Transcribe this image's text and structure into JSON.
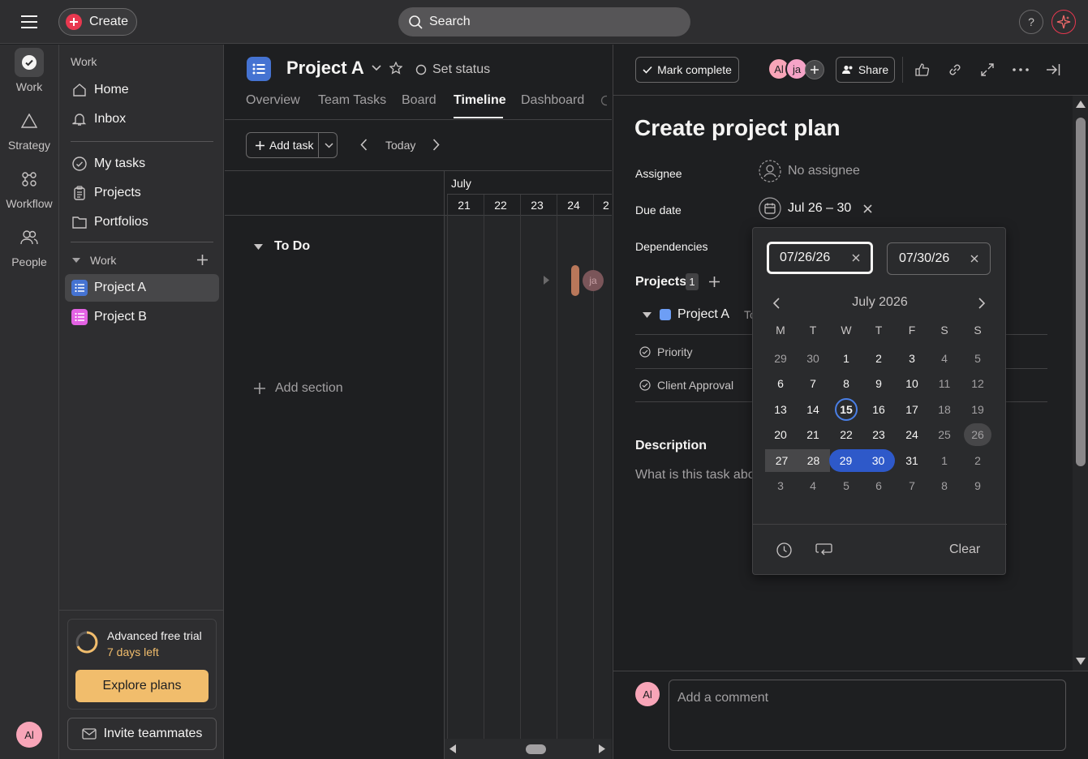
{
  "topbar": {
    "create_label": "Create",
    "search_placeholder": "Search",
    "help_label": "?"
  },
  "rail": [
    {
      "label": "Work"
    },
    {
      "label": "Strategy"
    },
    {
      "label": "Workflow"
    },
    {
      "label": "People"
    }
  ],
  "rail_avatar": "Al",
  "sidebar": {
    "section_label": "Work",
    "items": [
      {
        "label": "Home"
      },
      {
        "label": "Inbox"
      },
      {
        "label": "My tasks"
      },
      {
        "label": "Projects"
      },
      {
        "label": "Portfolios"
      }
    ],
    "work_group": "Work",
    "projects": [
      {
        "label": "Project A",
        "color": "#4573d2"
      },
      {
        "label": "Project B",
        "color": "#e362e3"
      }
    ],
    "trial_title": "Advanced free trial",
    "trial_days": "7 days left",
    "explore_label": "Explore plans",
    "invite_label": "Invite teammates"
  },
  "project": {
    "title": "Project A",
    "set_status": "Set status",
    "tabs": [
      "Overview",
      "Team Tasks",
      "Board",
      "Timeline",
      "Dashboard"
    ],
    "active_tab": "Timeline",
    "add_task": "Add task",
    "today": "Today",
    "month": "July",
    "days": [
      "21",
      "22",
      "23",
      "24",
      "2"
    ],
    "section": "To Do",
    "add_section": "Add section",
    "bar_avatar": "ja"
  },
  "detail": {
    "mark_complete": "Mark complete",
    "collab_avatars": [
      "Al",
      "ja"
    ],
    "share": "Share",
    "title": "Create project plan",
    "assignee_label": "Assignee",
    "assignee_value": "No assignee",
    "due_label": "Due date",
    "due_value": "Jul 26 – 30",
    "dependencies_label": "Dependencies",
    "projects_label": "Projects",
    "projects_count": "1",
    "project_name": "Project A",
    "project_section": "To",
    "fields": [
      "Priority",
      "Client Approval"
    ],
    "description_label": "Description",
    "description_placeholder": "What is this task abo",
    "comment_avatar": "Al",
    "comment_placeholder": "Add a comment"
  },
  "calendar": {
    "start": "07/26/26",
    "end": "07/30/26",
    "month_title": "July 2026",
    "weekdays": [
      "M",
      "T",
      "W",
      "T",
      "F",
      "S",
      "S"
    ],
    "weeks": [
      [
        "29",
        "30",
        "1",
        "2",
        "3",
        "4",
        "5"
      ],
      [
        "6",
        "7",
        "8",
        "9",
        "10",
        "11",
        "12"
      ],
      [
        "13",
        "14",
        "15",
        "16",
        "17",
        "18",
        "19"
      ],
      [
        "20",
        "21",
        "22",
        "23",
        "24",
        "25",
        "26"
      ],
      [
        "27",
        "28",
        "29",
        "30",
        "31",
        "1",
        "2"
      ],
      [
        "3",
        "4",
        "5",
        "6",
        "7",
        "8",
        "9"
      ]
    ],
    "today": "15",
    "clear": "Clear"
  }
}
